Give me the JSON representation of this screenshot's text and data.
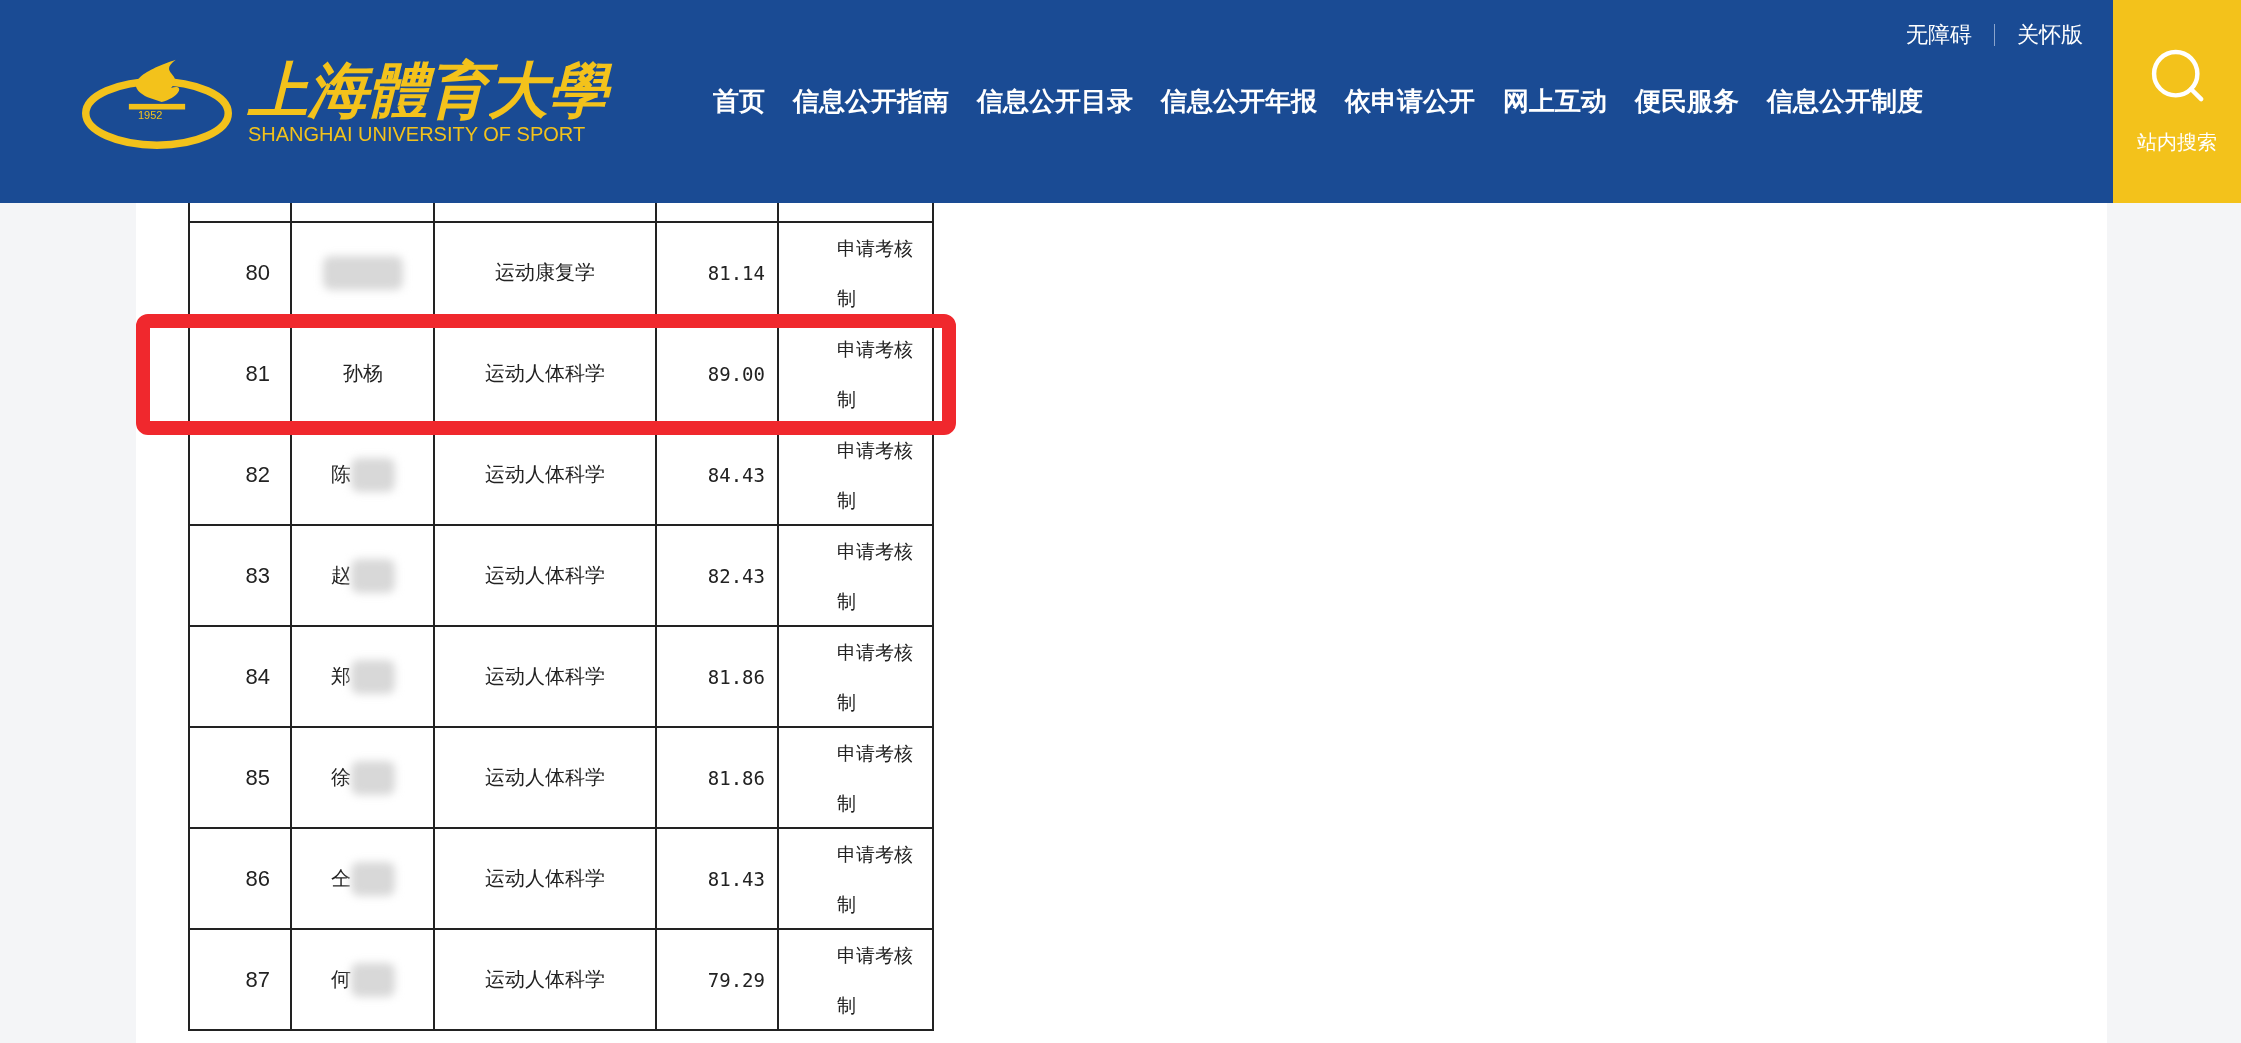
{
  "header": {
    "logo": {
      "emblem_year": "1952",
      "name_cn": "上海體育大學",
      "name_en": "SHANGHAI UNIVERSITY OF SPORT"
    },
    "nav": [
      "首页",
      "信息公开指南",
      "信息公开目录",
      "信息公开年报",
      "依申请公开",
      "网上互动",
      "便民服务",
      "信息公开制度"
    ],
    "top_links": [
      "无障碍",
      "关怀版"
    ],
    "search": {
      "label": "站内搜索"
    }
  },
  "table": {
    "rows": [
      {
        "no": "80",
        "redacted": true,
        "major": "运动康复学",
        "score": "81.14",
        "method": "申请考核制",
        "highlighted": false
      },
      {
        "no": "81",
        "name": "孙杨",
        "redacted": false,
        "major": "运动人体科学",
        "score": "89.00",
        "method": "申请考核制",
        "highlighted": true
      },
      {
        "no": "82",
        "name": "陈",
        "redacted": true,
        "major": "运动人体科学",
        "score": "84.43",
        "method": "申请考核制",
        "highlighted": false
      },
      {
        "no": "83",
        "name": "赵",
        "redacted": true,
        "major": "运动人体科学",
        "score": "82.43",
        "method": "申请考核制",
        "highlighted": false
      },
      {
        "no": "84",
        "name": "郑",
        "redacted": true,
        "major": "运动人体科学",
        "score": "81.86",
        "method": "申请考核制",
        "highlighted": false
      },
      {
        "no": "85",
        "name": "徐",
        "redacted": true,
        "major": "运动人体科学",
        "score": "81.86",
        "method": "申请考核制",
        "highlighted": false
      },
      {
        "no": "86",
        "name": "仝",
        "redacted": true,
        "major": "运动人体科学",
        "score": "81.43",
        "method": "申请考核制",
        "highlighted": false
      },
      {
        "no": "87",
        "name": "何",
        "redacted": true,
        "major": "运动人体科学",
        "score": "79.29",
        "method": "申请考核制",
        "highlighted": false
      }
    ]
  }
}
